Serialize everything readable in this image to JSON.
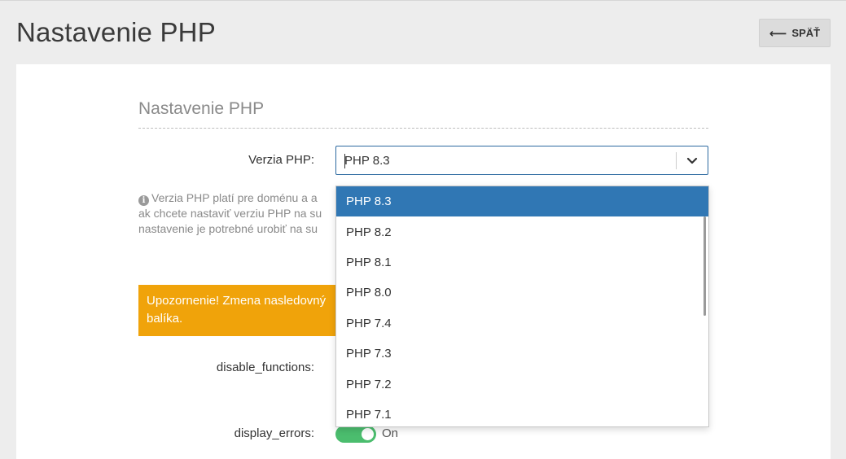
{
  "page": {
    "title": "Nastavenie PHP"
  },
  "toolbar": {
    "back_label": "SPÄŤ",
    "back_arrow": "⟵"
  },
  "section": {
    "title": "Nastavenie PHP"
  },
  "php_version": {
    "label": "Verzia PHP:",
    "selected": "PHP 8.3",
    "options": [
      "PHP 8.3",
      "PHP 8.2",
      "PHP 8.1",
      "PHP 8.0",
      "PHP 7.4",
      "PHP 7.3",
      "PHP 7.2",
      "PHP 7.1"
    ]
  },
  "help": {
    "lines": [
      "Verzia PHP platí pre doménu a a",
      "ak chcete nastaviť verziu PHP na su",
      "nastavenie je potrebné urobiť na su"
    ]
  },
  "warning": {
    "lines": [
      "Upozornenie! Zmena nasledovný",
      "balíka."
    ],
    "color": "#f0a30a"
  },
  "settings": {
    "disable_functions_label": "disable_functions:",
    "display_errors_label": "display_errors:",
    "display_errors_state": "On"
  },
  "colors": {
    "accent": "#3077b4",
    "toggle_on": "#4bbd6e"
  },
  "icons": {
    "back": "arrow-left-icon",
    "dropdown": "chevron-down-icon",
    "info": "info-icon"
  }
}
